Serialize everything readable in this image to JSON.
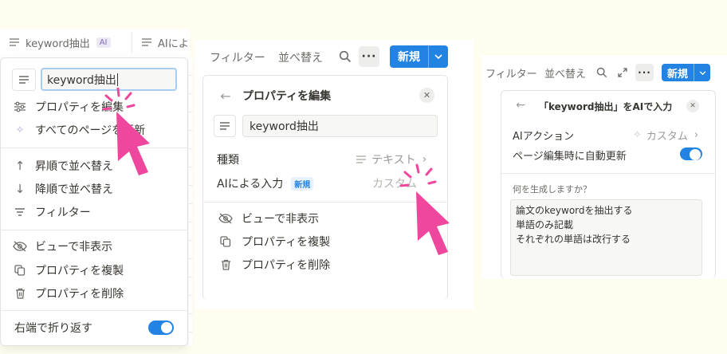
{
  "panel1": {
    "header_tabs": [
      {
        "icon": "text-lines-icon",
        "label": "keyword抽出",
        "badge": "AI"
      },
      {
        "icon": "text-lines-icon",
        "label": "AIによ"
      }
    ],
    "name_input_value": "keyword抽出",
    "menu_items": [
      {
        "icon": "sliders-icon",
        "label": "プロパティを編集"
      },
      {
        "icon": "sparkle-icon",
        "label": "すべてのページを更新"
      },
      {
        "icon": "arrow-up-icon",
        "label": "昇順で並べ替え"
      },
      {
        "icon": "arrow-down-icon",
        "label": "降順で並べ替え"
      },
      {
        "icon": "filter-icon",
        "label": "フィルター"
      },
      {
        "icon": "eye-slash-icon",
        "label": "ビューで非表示"
      },
      {
        "icon": "copy-icon",
        "label": "プロパティを複製"
      },
      {
        "icon": "trash-icon",
        "label": "プロパティを削除"
      }
    ],
    "wrap_label": "右端で折り返す",
    "wrap_on": true
  },
  "panel2": {
    "toolbar": {
      "filter": "フィルター",
      "sort": "並べ替え",
      "new": "新規"
    },
    "title": "プロパティを編集",
    "name_value": "keyword抽出",
    "type_label": "種類",
    "type_value": "テキスト",
    "ai_input_label": "AIによる入力",
    "ai_input_badge": "新規",
    "ai_input_value": "カスタム",
    "actions": [
      {
        "icon": "eye-slash-icon",
        "label": "ビューで非表示"
      },
      {
        "icon": "copy-icon",
        "label": "プロパティを複製"
      },
      {
        "icon": "trash-icon",
        "label": "プロパティを削除"
      }
    ]
  },
  "panel3": {
    "toolbar": {
      "filter": "フィルター",
      "sort": "並べ替え",
      "new": "新規"
    },
    "title": "「keyword抽出」をAIで入力",
    "ai_action_label": "AIアクション",
    "ai_action_value": "カスタム",
    "auto_update_label": "ページ編集時に自動更新",
    "auto_update_on": true,
    "prompt_label": "何を生成しますか？",
    "prompt_lines": [
      "論文のkeywordを抽出する",
      "単語のみ記載",
      "それぞれの単語は改行する"
    ]
  },
  "colors": {
    "accent": "#2383e2",
    "pointer": "#f0479e",
    "background": "#fffdf0"
  }
}
